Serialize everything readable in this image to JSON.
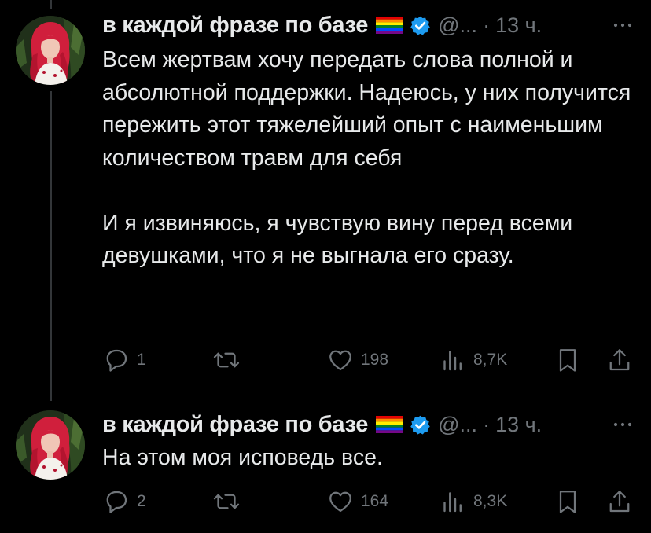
{
  "colors": {
    "background": "#000000",
    "text_primary": "#e7e9ea",
    "text_secondary": "#71767b",
    "verified_badge": "#1d9bf0",
    "thread_line": "#333639"
  },
  "tweets": [
    {
      "author_name": "в каждой фразе по базе",
      "name_emoji": "rainbow-flag-icon",
      "handle": "@...",
      "separator": "·",
      "time": "13 ч.",
      "paragraphs": [
        "Всем жертвам хочу передать слова полной и абсолютной поддержки. Надеюсь, у них получится пережить этот тяжелейший опыт с наименьшим количеством травм для себя",
        "И я извиняюсь, я чувствую вину перед всеми девушками, что я не выгнала его сразу."
      ],
      "replies": "1",
      "reposts": "",
      "likes": "198",
      "views": "8,7K"
    },
    {
      "author_name": "в каждой фразе по базе",
      "name_emoji": "rainbow-flag-icon",
      "handle": "@...",
      "separator": "·",
      "time": "13 ч.",
      "paragraphs": [
        "На этом моя исповедь все."
      ],
      "replies": "2",
      "reposts": "",
      "likes": "164",
      "views": "8,3K"
    }
  ]
}
